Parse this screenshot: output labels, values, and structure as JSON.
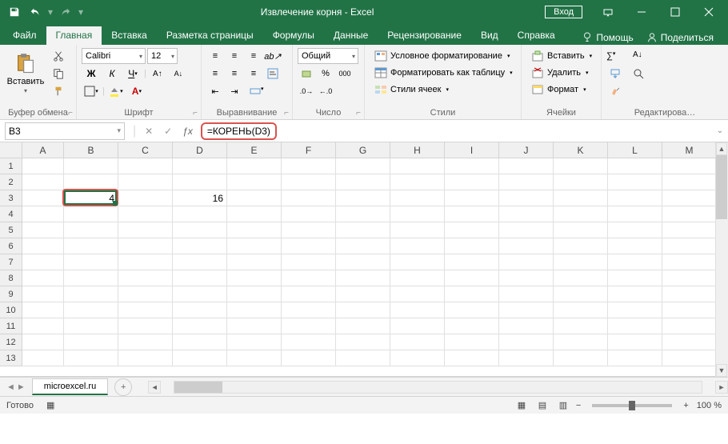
{
  "title": "Извлечение корня  -  Excel",
  "login": "Вход",
  "tabs": {
    "file": "Файл",
    "home": "Главная",
    "insert": "Вставка",
    "layout": "Разметка страницы",
    "formulas": "Формулы",
    "data": "Данные",
    "review": "Рецензирование",
    "view": "Вид",
    "help": "Справка",
    "tell": "Помощь",
    "share": "Поделиться"
  },
  "ribbon": {
    "clipboard": {
      "label": "Буфер обмена",
      "paste": "Вставить"
    },
    "font": {
      "label": "Шрифт",
      "name": "Calibri",
      "size": "12"
    },
    "align": {
      "label": "Выравнивание"
    },
    "number": {
      "label": "Число",
      "format": "Общий"
    },
    "styles": {
      "label": "Стили",
      "cond": "Условное форматирование",
      "table": "Форматировать как таблицу",
      "cell": "Стили ячеек"
    },
    "cells": {
      "label": "Ячейки",
      "insert": "Вставить",
      "delete": "Удалить",
      "format": "Формат"
    },
    "editing": {
      "label": "Редактирова…"
    }
  },
  "formula": {
    "cellref": "B3",
    "text": "=КОРЕНЬ(D3)"
  },
  "grid": {
    "cols": [
      "A",
      "B",
      "C",
      "D",
      "E",
      "F",
      "G",
      "H",
      "I",
      "J",
      "K",
      "L",
      "M"
    ],
    "col_widths": {
      "A": 52
    },
    "default_col_width": 68,
    "rows": 13,
    "data": {
      "B3": "4",
      "D3": "16"
    },
    "selection": "B3"
  },
  "sheet": {
    "name": "microexcel.ru"
  },
  "status": {
    "ready": "Готово",
    "zoom": "100 %"
  }
}
